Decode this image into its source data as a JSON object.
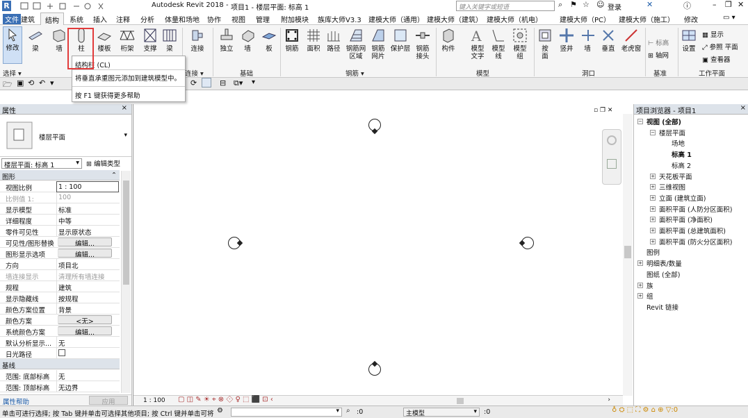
{
  "title": {
    "app": "Autodesk Revit 2018 -",
    "doc": "项目1 - 楼层平面: 标高 1",
    "search_placeholder": "键入关键字或短语",
    "login": "登录"
  },
  "tabs": [
    "文件",
    "建筑",
    "结构",
    "系统",
    "插入",
    "注释",
    "分析",
    "体量和场地",
    "协作",
    "视图",
    "管理",
    "附加模块",
    "族库大师V3.3",
    "建模大师（通用）",
    "建模大师（建筑）",
    "建模大师（机电）",
    "建模大师（PC）",
    "建模大师（施工）",
    "修改"
  ],
  "ribbon": {
    "buttons": [
      "修改",
      "梁",
      "墙",
      "柱",
      "楼板",
      "桁架",
      "支撑",
      "梁",
      "连接",
      "独立",
      "墙",
      "板",
      "钢筋",
      "面积",
      "路径",
      "钢筋网\n区域",
      "钢筋\n网片",
      "保护层",
      "钢筋\n接头",
      "构件",
      "模型\n文字",
      "模型\n线",
      "模型\n组",
      "按\n面",
      "竖井",
      "墙",
      "垂直",
      "老虎窗",
      "标高",
      "轴网",
      "设置"
    ],
    "side_right": [
      "显示",
      "参照 平面",
      "查看器"
    ],
    "groups": [
      "选择 ▾",
      "连接 ▾",
      "基础",
      "钢筋 ▾",
      "模型",
      "洞口",
      "基准",
      "工作平面"
    ]
  },
  "tooltip": {
    "title": "结构柱 (CL)",
    "desc": "将垂直承重图元添加到建筑模型中。",
    "help": "按 F1 键获得更多帮助"
  },
  "properties": {
    "header": "属性",
    "type_name": "楼层平面",
    "selector": "楼层平面: 标高 1",
    "edit_type": "编辑类型",
    "sections": [
      "图形",
      "基线"
    ],
    "rows": [
      {
        "k": "视图比例",
        "v": "1 : 100"
      },
      {
        "k": "比例值 1:",
        "v": "100"
      },
      {
        "k": "显示模型",
        "v": "标准"
      },
      {
        "k": "详细程度",
        "v": "中等"
      },
      {
        "k": "零件可见性",
        "v": "显示原状态"
      },
      {
        "k": "可见性/图形替换",
        "v": "编辑..."
      },
      {
        "k": "图形显示选项",
        "v": "编辑..."
      },
      {
        "k": "方向",
        "v": "项目北"
      },
      {
        "k": "墙连接显示",
        "v": "清理所有墙连接"
      },
      {
        "k": "规程",
        "v": "建筑"
      },
      {
        "k": "显示隐藏线",
        "v": "按规程"
      },
      {
        "k": "颜色方案位置",
        "v": "背景"
      },
      {
        "k": "颜色方案",
        "v": "<无>"
      },
      {
        "k": "系统颜色方案",
        "v": "编辑..."
      },
      {
        "k": "默认分析显示...",
        "v": "无"
      },
      {
        "k": "日光路径",
        "v": ""
      },
      {
        "k": "范围: 底部标高",
        "v": "无"
      },
      {
        "k": "范围: 顶部标高",
        "v": "无边界"
      }
    ],
    "help_link": "属性帮助",
    "apply": "应用"
  },
  "canvas": {
    "scale": "1 : 100"
  },
  "browser": {
    "header": "项目浏览器 - 项目1",
    "items": [
      "视图 (全部)",
      "楼层平面",
      "场地",
      "标高 1",
      "标高 2",
      "天花板平面",
      "三维视图",
      "立面 (建筑立面)",
      "面积平面 (人防分区面积)",
      "面积平面 (净面积)",
      "面积平面 (总建筑面积)",
      "面积平面 (防火分区面积)",
      "图例",
      "明细表/数量",
      "图纸 (全部)",
      "族",
      "组",
      "Revit 链接"
    ]
  },
  "status": {
    "text": "单击可进行选择; 按 Tab 键并单击可选择其他项目; 按 Ctrl 键并单击可将",
    "coord": ":0",
    "model": "主模型",
    "coord2": ":0"
  }
}
